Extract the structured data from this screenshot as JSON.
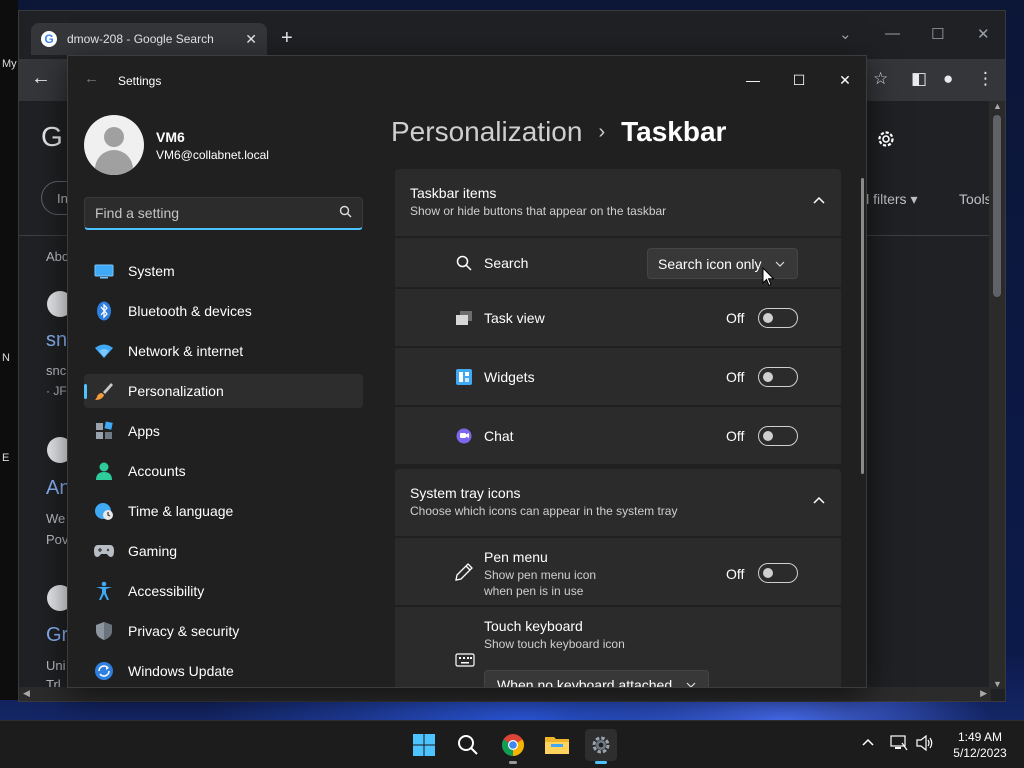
{
  "browser": {
    "tab_title": "dmow-208 - Google Search",
    "favicon_letter": "G",
    "newtab_glyph": "+",
    "close_glyph": "✕",
    "back_glyph": "←",
    "bookmark_label": "My",
    "page_bits": {
      "logo_fragment": "G",
      "chip_fragment": "In",
      "about_fragment": "Abo",
      "result1_title": "sn",
      "result1_line1": "snc",
      "result1_line2": "· JF",
      "result2_title": "An",
      "result2_line1": "We",
      "result2_line2": "Pov",
      "result3_title": "Gr",
      "result3_line1": "Uni",
      "result3_line2": "Trl",
      "all_filters": "ll filters",
      "tools": "Tools"
    },
    "left_edge_text": [
      "N",
      "E"
    ]
  },
  "settings": {
    "window_title": "Settings",
    "profile": {
      "name": "VM6",
      "email": "VM6@collabnet.local"
    },
    "search": {
      "placeholder": "Find a setting"
    },
    "nav_items": [
      {
        "label": "System",
        "icon": "monitor-icon"
      },
      {
        "label": "Bluetooth & devices",
        "icon": "bluetooth-icon"
      },
      {
        "label": "Network & internet",
        "icon": "wifi-icon"
      },
      {
        "label": "Personalization",
        "icon": "brush-icon",
        "selected": true
      },
      {
        "label": "Apps",
        "icon": "apps-icon"
      },
      {
        "label": "Accounts",
        "icon": "person-icon"
      },
      {
        "label": "Time & language",
        "icon": "globe-clock-icon"
      },
      {
        "label": "Gaming",
        "icon": "gamepad-icon"
      },
      {
        "label": "Accessibility",
        "icon": "accessibility-icon"
      },
      {
        "label": "Privacy & security",
        "icon": "shield-icon"
      },
      {
        "label": "Windows Update",
        "icon": "update-icon"
      }
    ],
    "breadcrumb": {
      "parent": "Personalization",
      "separator": "›",
      "current": "Taskbar"
    },
    "taskbar_items": {
      "title": "Taskbar items",
      "subtitle": "Show or hide buttons that appear on the taskbar",
      "rows": [
        {
          "label": "Search",
          "control": "dropdown",
          "value": "Search icon only"
        },
        {
          "label": "Task view",
          "state": "Off"
        },
        {
          "label": "Widgets",
          "state": "Off"
        },
        {
          "label": "Chat",
          "state": "Off"
        }
      ]
    },
    "system_tray": {
      "title": "System tray icons",
      "subtitle": "Choose which icons can appear in the system tray",
      "pen_menu": {
        "label": "Pen menu",
        "sub1": "Show pen menu icon",
        "sub2": "when pen is in use",
        "state": "Off"
      },
      "touch_keyboard": {
        "label": "Touch keyboard",
        "sub": "Show touch keyboard icon",
        "dropdown": "When no keyboard attached"
      }
    }
  },
  "taskbar": {
    "time": "1:49 AM",
    "date": "5/12/2023"
  },
  "colors": {
    "accent": "#4cc2ff",
    "settings_bg": "#202020",
    "card_bg": "#2b2b2b"
  }
}
